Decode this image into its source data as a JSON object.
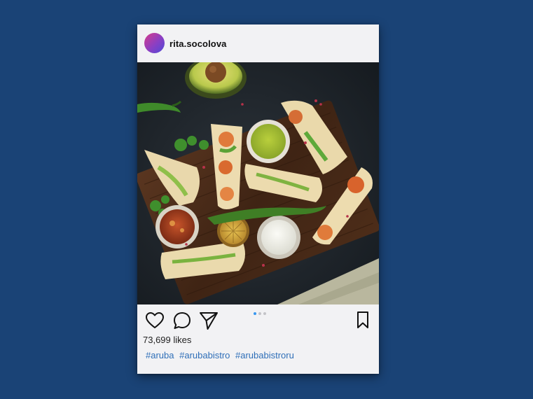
{
  "post": {
    "username": "rita.socolova",
    "likes_text": "73,699 likes",
    "hashtags": [
      "#aruba",
      "#arubabistro",
      "#arubabistroru"
    ],
    "pager": {
      "total": 3,
      "active_index": 0
    }
  },
  "icons": {
    "like": "heart-icon",
    "comment": "comment-bubble-icon",
    "share": "paper-plane-icon",
    "save": "bookmark-icon"
  },
  "colors": {
    "page_background": "#1a4376",
    "card_background": "#f2f2f4",
    "hashtag": "#2f6fb8",
    "pager_active": "#3897f0"
  }
}
